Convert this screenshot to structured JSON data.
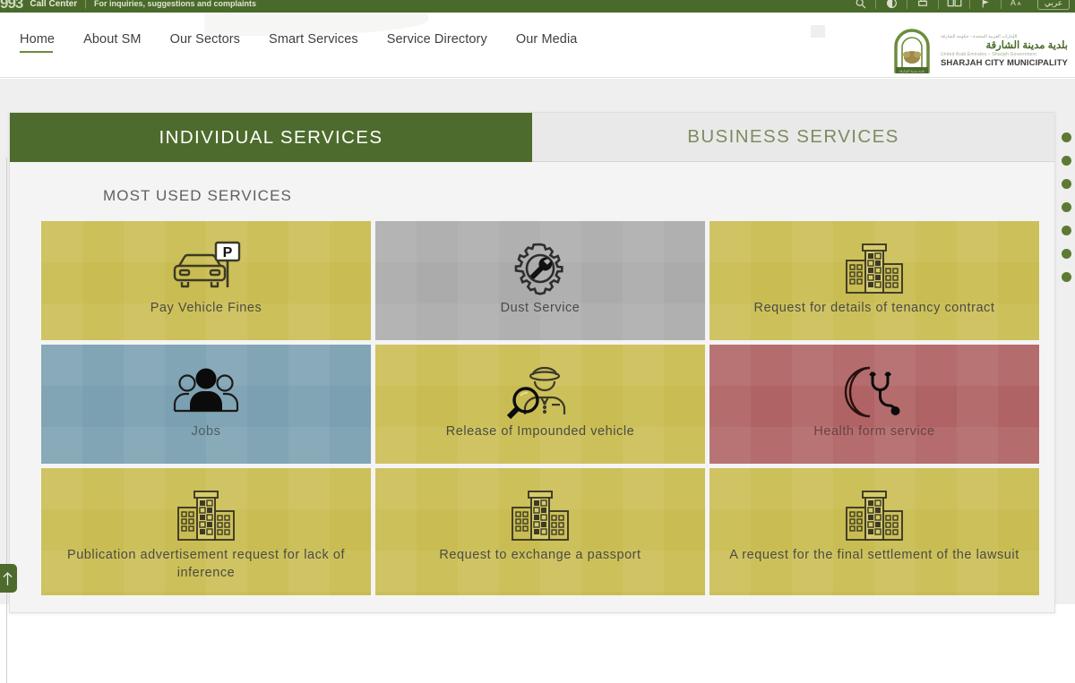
{
  "topbar": {
    "brand": "Call Center",
    "tagline": "For inquiries, suggestions and complaints",
    "lang_label": "عربي",
    "icons": [
      "search-icon",
      "contrast-icon",
      "print-icon",
      "keyboard-icon",
      "flag-icon",
      "text-size-icon"
    ]
  },
  "nav": {
    "items": [
      {
        "label": "Home",
        "active": true
      },
      {
        "label": "About SM",
        "active": false
      },
      {
        "label": "Our Sectors",
        "active": false
      },
      {
        "label": "Smart Services",
        "active": false
      },
      {
        "label": "Service Directory",
        "active": false
      },
      {
        "label": "Our Media",
        "active": false
      }
    ]
  },
  "logo": {
    "arabic_small": "الإمارات العربية المتحدة - حكومة الشارقة",
    "arabic_big": "بلدية مدينة الشارقة",
    "english_small": "United Arab Emirates – Sharjah Government",
    "english_big": "SHARJAH CITY MUNICIPALITY"
  },
  "tabs": [
    {
      "label": "INDIVIDUAL SERVICES",
      "active": true
    },
    {
      "label": "BUSINESS SERVICES",
      "active": false
    }
  ],
  "section": {
    "title": "MOST USED SERVICES"
  },
  "services": [
    {
      "label": "Pay Vehicle Fines",
      "icon": "car-parking-sign-icon",
      "color": "#c9bc52",
      "theme": "yellow"
    },
    {
      "label": "Dust Service",
      "icon": "gear-wrench-icon",
      "color": "#ababab",
      "theme": "gray"
    },
    {
      "label": "Request for details of tenancy contract",
      "icon": "building-icon",
      "color": "#c9bc52",
      "theme": "yellow"
    },
    {
      "label": "Jobs",
      "icon": "people-group-icon",
      "color": "#7aa0b1",
      "theme": "blue"
    },
    {
      "label": "Release of Impounded vehicle",
      "icon": "police-officer-magnifier-icon",
      "color": "#c9bc52",
      "theme": "yellow"
    },
    {
      "label": "Health form service",
      "icon": "crescent-stethoscope-icon",
      "color": "#b06365",
      "theme": "red"
    },
    {
      "label": "Publication advertisement request for lack of inference",
      "icon": "building-icon",
      "color": "#c9bc52",
      "theme": "yellow"
    },
    {
      "label": "Request to exchange a passport",
      "icon": "building-icon",
      "color": "#c9bc52",
      "theme": "yellow"
    },
    {
      "label": "A request for the final settlement of the lawsuit",
      "icon": "building-icon",
      "color": "#c9bc52",
      "theme": "yellow"
    }
  ],
  "page_dots": {
    "count": 7,
    "color": "#5d7a33"
  },
  "scroll_top": {
    "icon": "arrow-up-icon"
  },
  "theme": {
    "green": "#4d6b2c",
    "yellow": "#c9bc52",
    "gray": "#ababab",
    "blue": "#7aa0b1",
    "red": "#b06365"
  }
}
